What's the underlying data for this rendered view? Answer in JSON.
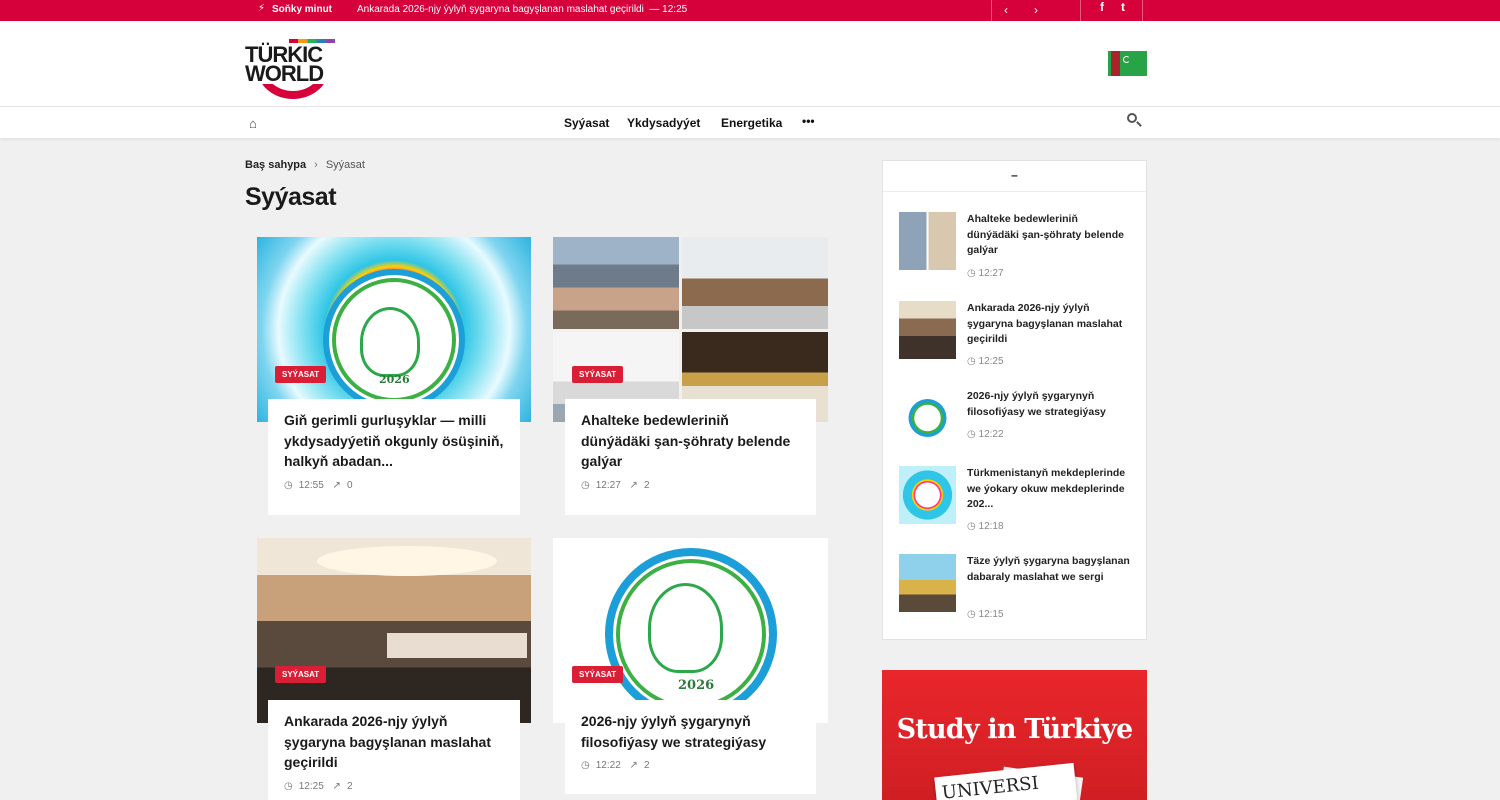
{
  "topbar": {
    "label": "Soňky minut",
    "headline": "Ankarada 2026-njy ýylyň şygaryna bagyşlanan maslahat geçirildi",
    "headline_time": "— 12:25",
    "prev_icon": "‹",
    "next_icon": "›",
    "facebook": "f",
    "twitter": "t"
  },
  "header": {
    "logo_line1": "TÜRKIC",
    "logo_line2": "WORLD"
  },
  "nav": {
    "items": [
      "Syýasat",
      "Ykdysadyýet",
      "Energetika"
    ],
    "more": "•••"
  },
  "breadcrumb": {
    "home": "Baş sahypa",
    "separator": "›",
    "current": "Syýasat"
  },
  "page_title": "Syýasat",
  "articles": [
    {
      "badge": "SYÝASAT",
      "title": "Giň gerimli gurluşyklar — milli ykdysadyýetiň okgunly ösüşiniň, halkyň abadan...",
      "time": "12:55",
      "views": "0"
    },
    {
      "badge": "SYÝASAT",
      "title": "Ahalteke bedewleriniň dünýädäki şan-şöhraty belende galýar",
      "time": "12:27",
      "views": "2"
    },
    {
      "badge": "SYÝASAT",
      "title": "Ankarada 2026-njy ýylyň şygaryna bagyşlanan maslahat geçirildi",
      "time": "12:25",
      "views": "2"
    },
    {
      "badge": "SYÝASAT",
      "title": "2026-njy ýylyň şygarynyň filosofiýasy we strategiýasy",
      "time": "12:22",
      "views": "2"
    }
  ],
  "emblem_year": "2026",
  "sidebar": {
    "heading": "–",
    "items": [
      {
        "title": "Ahalteke bedewleriniň dünýädäki şan-şöhraty belende galýar",
        "time": "12:27"
      },
      {
        "title": "Ankarada 2026-njy ýylyň şygaryna bagyşlanan maslahat geçirildi",
        "time": "12:25"
      },
      {
        "title": "2026-njy ýylyň şygarynyň filosofiýasy we strategiýasy",
        "time": "12:22"
      },
      {
        "title": "Türkmenistanyň mekdeplerinde we ýokary okuw mekdeplerinde 202...",
        "time": "12:18"
      },
      {
        "title": "Täze ýylyň şygaryna bagyşlanan dabaraly maslahat we sergi",
        "time": "12:15"
      }
    ]
  },
  "ad": {
    "title": "Study in Türkiye",
    "paper_text": "UNIVERSI"
  },
  "icons": {
    "clock": "◷",
    "trend": "↗",
    "home": "⌂",
    "bolt": "⚡"
  },
  "colors": {
    "brand": "#d6003b",
    "badge": "#d81f36",
    "ad": "#e9262b"
  }
}
